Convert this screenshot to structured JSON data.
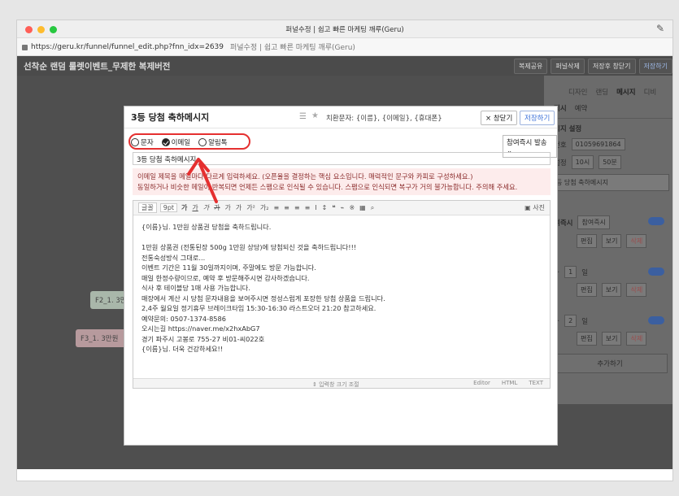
{
  "window": {
    "title": "퍼널수정 | 쉽고 빠른 마케팅 깨루(Geru)"
  },
  "urlbar": {
    "url": "https://geru.kr/funnel/funnel_edit.php?fnn_idx=2639",
    "page_title": "퍼널수정 | 쉽고 빠른 마케팅 깨루(Geru)"
  },
  "app": {
    "title": "선착순 랜덤 룰렛이벤트_무제한 복제버전"
  },
  "topbar": {
    "buttons": [
      "복제공유",
      "퍼널삭제",
      "저장후 창닫기",
      "저장하기"
    ]
  },
  "nodes": {
    "f2": "F2_1. 3만원",
    "f3": "F3_1. 3만원"
  },
  "right_panel": {
    "tabs": [
      "디자인",
      "랜딩",
      "메시지",
      "디비"
    ],
    "active_tab": "메시지",
    "sub_tabs": [
      "지시",
      "예약"
    ],
    "settings_label": "시지 설정",
    "phone_label": "번호",
    "phone_value": "01059691864",
    "time_label": "설정",
    "time_hour": "10시",
    "time_min": "50분",
    "message_name": "등 당첨 축하메시지",
    "send_label": "여즉시",
    "send_value": "참여즉시",
    "edit": "편집",
    "view": "보기",
    "delete": "삭제",
    "day1_prefix": "+",
    "day1_value": "1",
    "day2_value": "2",
    "day_unit": "일",
    "add_button": "추가하기"
  },
  "modal": {
    "title": "3등 당첨 축하메시지",
    "substitution": "치환문자: {이름}, {이메일}, {휴대폰}",
    "close_button": "× 창닫기",
    "save_button": "저장하기",
    "radio": {
      "sms": "문자",
      "email": "이메일",
      "alimtalk": "알림톡",
      "selected": "이메일"
    },
    "send_select": "참여즉시 발송",
    "subject_value": "3등 당첨 축하메시지",
    "notice_line1": "이메일 제목을 메일마다 다르게 입력하세요. (오픈율을 결정하는 핵심 요소입니다. 매력적인 문구와 카피로 구성하세요.)",
    "notice_line2": "동일하거나 비슷한 메일이 반복되면 언제든 스팸으로 인식될 수 있습니다. 스팸으로 인식되면 복구가 거의 불가능합니다. 주의해 주세요.",
    "toolbar": {
      "font": "글꼴",
      "size": "9pt",
      "picture": "사진"
    },
    "body_lines": [
      "{이름}님. 1만원 상품권 당첨을 축하드립니다.",
      "",
      "1만원 상품권 (전통된장 500g 1만원 상당)에 당첨되신 것을 축하드립니다!!!",
      "전통숙성방식 그대로...",
      "이벤트 기간은 11월 30일까지이며, 주말에도 방문 가능합니다.",
      "매일 한정수량이므로, 예약 후 방문해주시면 감사하겠습니다.",
      "식사 후 테이블당 1매 사용 가능합니다.",
      "매장에서 계산 시 당첨 문자내용을 보여주시면 정성스럽게 포장한 당첨 상품을 드립니다.",
      "2,4주 월요일 정기휴무 브레이크타임 15:30-16:30 라스트오더 21:20 참고하세요.",
      "예약문의: 0507-1374-8586",
      "오시는길 https://naver.me/x2hxAbG7",
      "경기 파주시 고봉로 755-27 비01-씨022호",
      "{이름}님. 더욱 건강하세요!!"
    ],
    "resize_label": "⇕ 입력창 크기 조절",
    "modes": [
      "Editor",
      "HTML",
      "TEXT"
    ]
  },
  "colors": {
    "highlight": "#e53030",
    "accent": "#3a6fd8",
    "notice_bg": "#fdecec"
  }
}
